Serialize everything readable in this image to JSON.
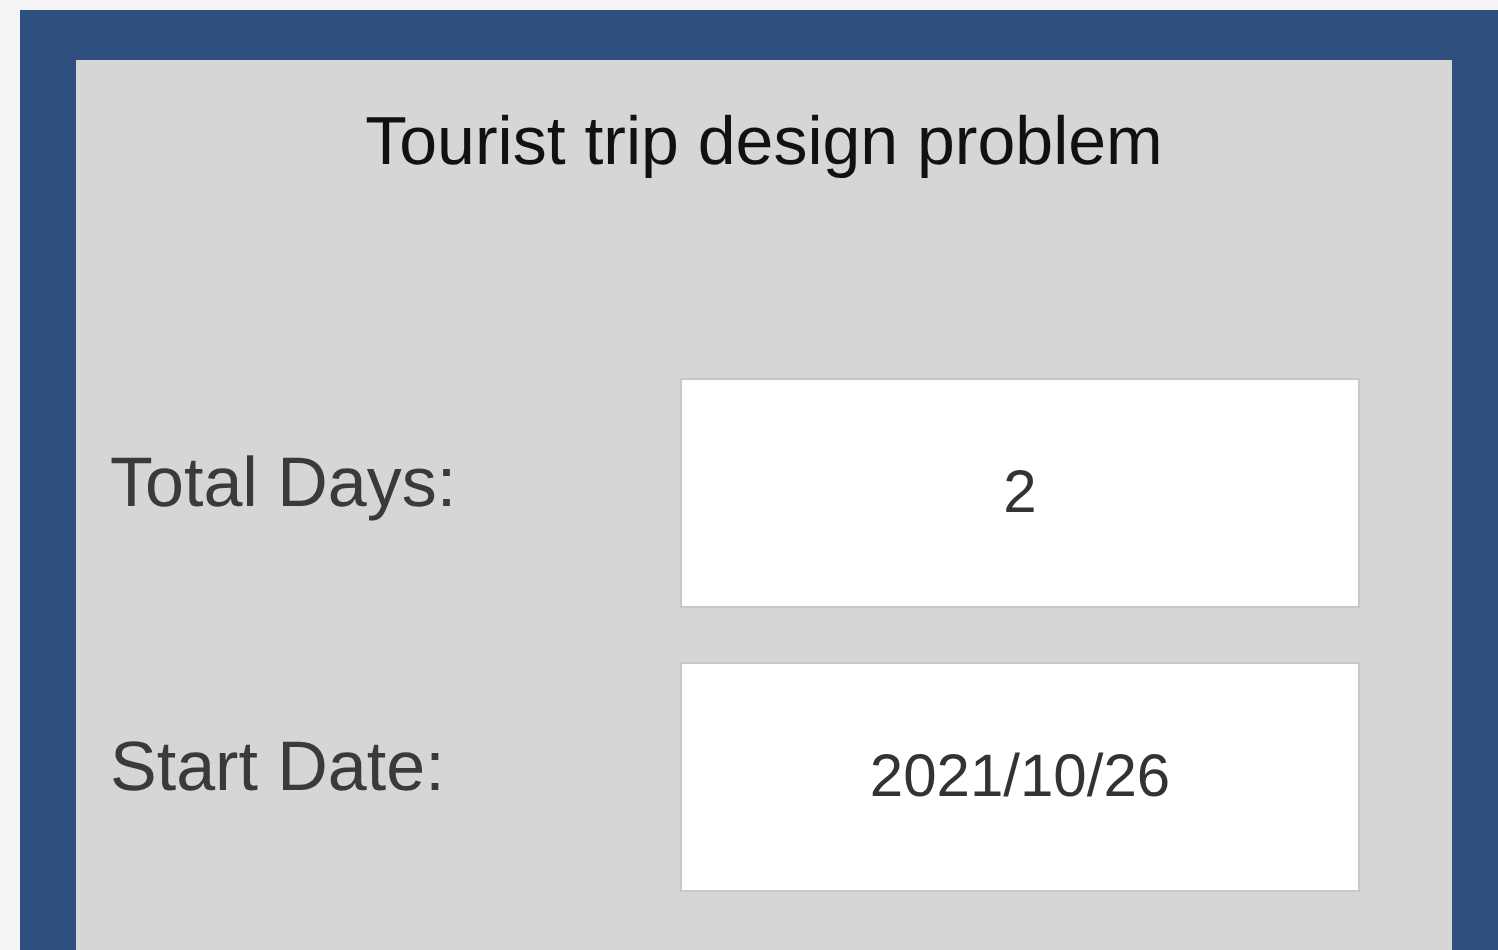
{
  "title": "Tourist trip design problem",
  "fields": [
    {
      "label": "Total Days:",
      "value": "2"
    },
    {
      "label": "Start Date:",
      "value": "2021/10/26"
    }
  ]
}
